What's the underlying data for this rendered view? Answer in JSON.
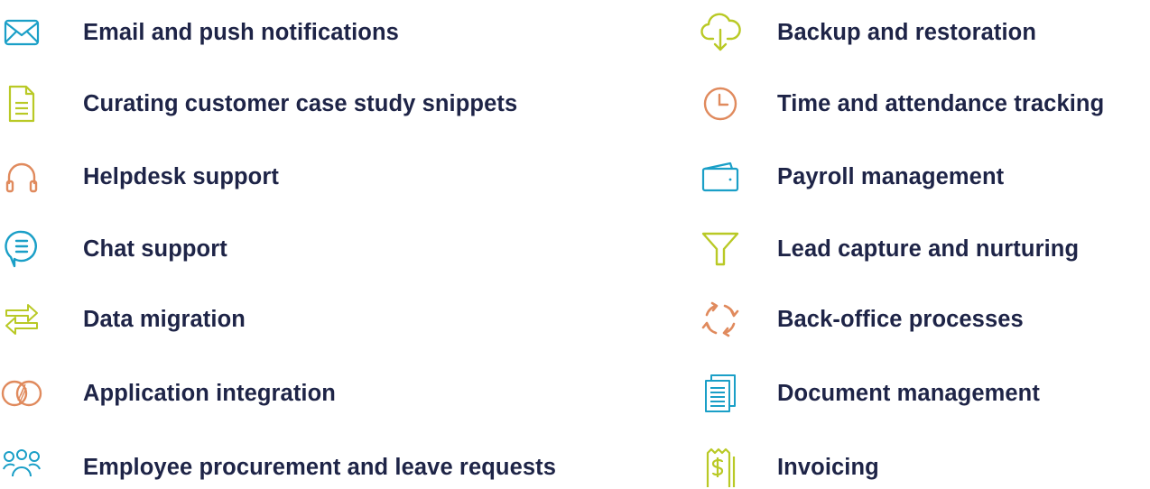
{
  "left_items": [
    {
      "label": "Email and push notifications",
      "icon": "envelope-icon",
      "color": "#1a9fc7"
    },
    {
      "label": "Curating customer case study snippets",
      "icon": "document-icon",
      "color": "#b9c925"
    },
    {
      "label": "Helpdesk support",
      "icon": "headphones-icon",
      "color": "#e08a5d"
    },
    {
      "label": "Chat support",
      "icon": "chat-bubble-icon",
      "color": "#1a9fc7"
    },
    {
      "label": "Data migration",
      "icon": "transfer-arrows-icon",
      "color": "#b9c925"
    },
    {
      "label": "Application integration",
      "icon": "overlapping-circles-icon",
      "color": "#e08a5d"
    },
    {
      "label": "Employee procurement and leave requests",
      "icon": "people-group-icon",
      "color": "#1a9fc7"
    }
  ],
  "right_items": [
    {
      "label": "Backup and restoration",
      "icon": "cloud-download-icon",
      "color": "#b9c925"
    },
    {
      "label": "Time and attendance tracking",
      "icon": "clock-icon",
      "color": "#e08a5d"
    },
    {
      "label": "Payroll management",
      "icon": "wallet-icon",
      "color": "#1a9fc7"
    },
    {
      "label": "Lead capture and nurturing",
      "icon": "funnel-icon",
      "color": "#b9c925"
    },
    {
      "label": "Back-office processes",
      "icon": "refresh-cycle-icon",
      "color": "#e08a5d"
    },
    {
      "label": "Document management",
      "icon": "stacked-documents-icon",
      "color": "#1a9fc7"
    },
    {
      "label": "Invoicing",
      "icon": "receipt-icon",
      "color": "#b9c925"
    }
  ]
}
